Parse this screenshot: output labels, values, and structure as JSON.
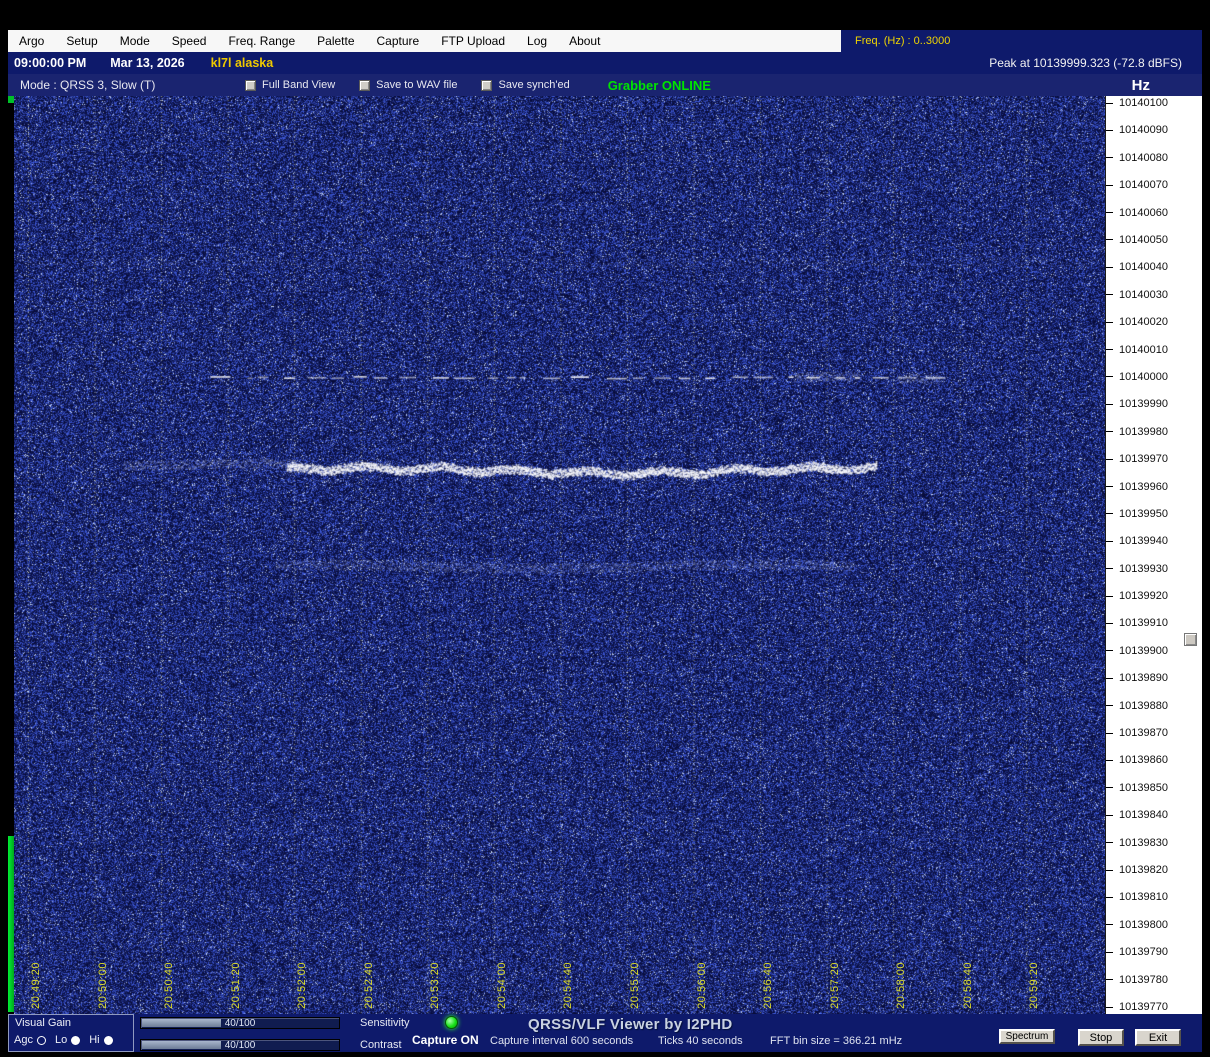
{
  "menubar": {
    "items": [
      "Argo",
      "Setup",
      "Mode",
      "Speed",
      "Freq. Range",
      "Palette",
      "Capture",
      "FTP Upload",
      "Log",
      "About"
    ],
    "freq_range_label": "Freq. (Hz) :  0..3000"
  },
  "statusbar": {
    "time": "09:00:00 PM",
    "date": "Mar 13, 2026",
    "callsign": "kl7l alaska",
    "peak": "Peak at 10139999.323 (-72.8 dBFS)"
  },
  "modebar": {
    "mode_label": "Mode : QRSS 3, Slow  (T)",
    "checkboxes": [
      {
        "label": "Full Band View",
        "checked": false
      },
      {
        "label": "Save to WAV file",
        "checked": false
      },
      {
        "label": "Save synch'ed",
        "checked": false
      }
    ],
    "grabber_status": "Grabber ONLINE",
    "hz_label": "Hz"
  },
  "freq_scale": {
    "unit": "Hz",
    "labels": [
      "10140100",
      "10140090",
      "10140080",
      "10140070",
      "10140060",
      "10140050",
      "10140040",
      "10140030",
      "10140020",
      "10140010",
      "10140000",
      "10139990",
      "10139980",
      "10139970",
      "10139960",
      "10139950",
      "10139940",
      "10139930",
      "10139920",
      "10139910",
      "10139900",
      "10139890",
      "10139880",
      "10139870",
      "10139860",
      "10139850",
      "10139840",
      "10139830",
      "10139820",
      "10139810",
      "10139800",
      "10139790",
      "10139780",
      "10139770"
    ]
  },
  "timeline": {
    "tick_interval": "40 seconds",
    "labels": [
      "20:49:20",
      "20:50:00",
      "20:50:40",
      "20:51:20",
      "20:52:00",
      "20:52:40",
      "20:53:20",
      "20:54:00",
      "20:54:40",
      "20:55:20",
      "20:56:00",
      "20:56:40",
      "20:57:20",
      "20:58:00",
      "20:58:40",
      "20:59:20"
    ]
  },
  "spectrogram": {
    "colors": {
      "background": "#081050",
      "speckle": "#8f9cff",
      "signal": "#ffffff",
      "gridline": "#f0f0aa"
    },
    "signals": [
      {
        "name": "upper-faint-band",
        "freq_hz": 10140042,
        "x_start": 0.0,
        "x_end": 1.0,
        "style": "faint"
      },
      {
        "name": "carrier-dashed-line",
        "freq_hz": 10140000,
        "x_start": 0.18,
        "x_end": 0.86,
        "style": "dashed"
      },
      {
        "name": "carrier-burst",
        "freq_hz": 10140000,
        "x_start": 0.715,
        "x_end": 0.775,
        "style": "fuzzy"
      },
      {
        "name": "carrier-burst-2",
        "freq_hz": 10139999,
        "x_start": 0.81,
        "x_end": 0.85,
        "style": "fuzzy"
      },
      {
        "name": "main-qrss-lead",
        "freq_hz": 10139968,
        "x_start": 0.1,
        "x_end": 0.26,
        "style": "fuzzy"
      },
      {
        "name": "main-qrss-trace",
        "freq_hz": 10139966,
        "x_start": 0.25,
        "x_end": 0.79,
        "style": "strong"
      },
      {
        "name": "lower-fuzzy-band",
        "freq_hz": 10139931,
        "x_start": 0.24,
        "x_end": 0.77,
        "style": "faintband"
      }
    ]
  },
  "bottombar": {
    "visual_gain": {
      "title": "Visual Gain",
      "options": [
        {
          "label": "Agc",
          "selected": false
        },
        {
          "label": "Lo",
          "selected": true
        },
        {
          "label": "Hi",
          "selected": true
        }
      ]
    },
    "sliders": [
      {
        "value": "40/100",
        "label": "Sensitivity"
      },
      {
        "value": "40/100",
        "label": "Contrast"
      }
    ],
    "capture_status": "Capture ON",
    "capture_interval": "Capture interval 600 seconds",
    "app_title": "QRSS/VLF Viewer by I2PHD",
    "ticks": "Ticks  40 seconds",
    "fft": "FFT bin size = 366.21 mHz",
    "buttons": [
      "Spectrum",
      "Stop",
      "Exit"
    ]
  }
}
